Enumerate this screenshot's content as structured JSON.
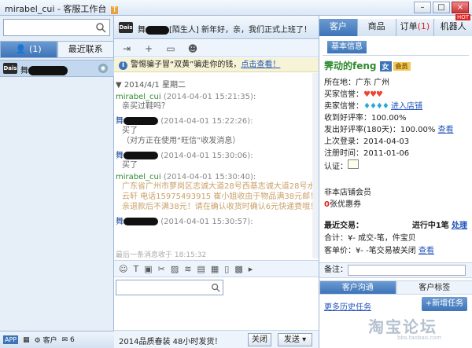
{
  "window": {
    "title": "mirabel_cui - 客服工作台",
    "badge": "T"
  },
  "left": {
    "tabs": [
      {
        "label": "👤 (1)"
      },
      {
        "label": "最近联系"
      }
    ],
    "contact_avatar": "Dais",
    "footer": {
      "app": "APP",
      "customer": "客户",
      "mail_count": "6"
    }
  },
  "chat": {
    "header_text": "[陌生人] 新年好，亲，我们正式上班了！",
    "notice": {
      "text": "警惕骗子冒“双黄”骗走你的钱，",
      "link": "点击查看！"
    },
    "date": "2014/4/1 星期二",
    "messages": [
      {
        "from": "mirabel_cui",
        "time": "(2014-04-01 15:21:35):",
        "body": "亲买过鞋吗？",
        "style": "green"
      },
      {
        "from": "",
        "time": "(2014-04-01 15:22:26):",
        "body": "买了",
        "body2": "（对方正在使用“旺信”收发消息）",
        "style": "blue"
      },
      {
        "from": "",
        "time": "(2014-04-01 15:30:06):",
        "body": "买了",
        "style": "blue"
      },
      {
        "from": "mirabel_cui",
        "time": "(2014-04-01 15:30:40):",
        "body": "广东省广州市萝岗区志诚大道28号西基志诚大道28号水云轩 电话15975493915 崔小姐收由于物品满38元邮！亲退款后不满38元！请在确认收货时确认6元快递费哦！",
        "style": "green"
      },
      {
        "from": "",
        "time": "(2014-04-01 15:30:57):",
        "body": "",
        "style": "blue"
      }
    ],
    "last_msg": "最后一条消息收于 18:15:32",
    "footer": {
      "promo": "2014品质春装 48小时发货！",
      "close": "关闭",
      "send": "发送"
    }
  },
  "right": {
    "tabs": [
      {
        "label": "客户"
      },
      {
        "label": "商品"
      },
      {
        "label": "订单(1)"
      },
      {
        "label": "机器人"
      }
    ],
    "hot": "HOT",
    "basic_info": "基本信息",
    "customer_name": "霁动的feng",
    "gender_badge": "女",
    "vip_badge": "会员",
    "location_label": "所在地：",
    "location": "广东 广州",
    "buyer_credit_label": "买家信誉：",
    "seller_credit_label": "卖家信誉：",
    "enter_shop": "进入店铺",
    "recv_rate_label": "收到好评率：",
    "recv_rate": "100.00%",
    "sent_rate_label": "发出好评率(180天)：",
    "sent_rate": "100.00%",
    "view": "查看",
    "last_login_label": "上次登录：",
    "last_login": "2014-04-03",
    "reg_label": "注册时间：",
    "reg_date": "2011-01-06",
    "auth_label": "认证：",
    "non_member": "非本店铺会员",
    "coupon_count": "0",
    "coupon_label": "张优惠券",
    "recent_label": "最近交易：",
    "in_progress": "进行中1笔",
    "handle": "处理",
    "total_label": "合计：",
    "total_value": "¥-  成交-笔，件宝贝",
    "avg_label": "客单价：",
    "avg_value": "¥-  -笔交易被关闭",
    "remark_label": "备注：",
    "subtabs": [
      {
        "label": "客户沟通"
      },
      {
        "label": "客户标签"
      }
    ],
    "more_history": "更多历史任务",
    "new_task": "+新增任务"
  },
  "watermark": {
    "main": "淘宝论坛",
    "sub": "bbs.taobao.com"
  }
}
